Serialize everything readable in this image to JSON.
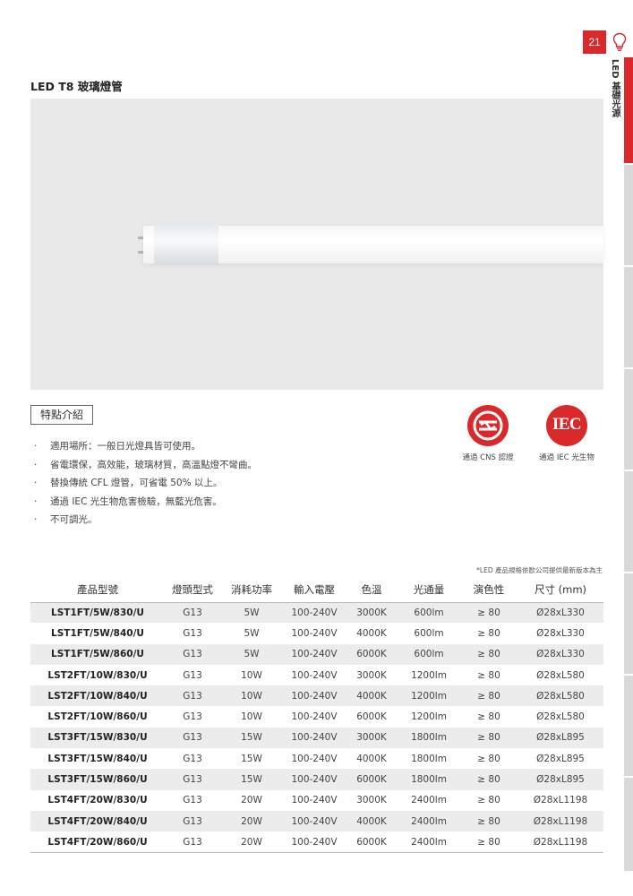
{
  "header": {
    "page_number": "21",
    "section_label": "LED 基礎光源",
    "bulb_icon": "lightbulb-icon",
    "accent_color": "#d9292a"
  },
  "title": "LED T8 玻璃燈管",
  "features": {
    "label": "特點介紹",
    "items": [
      "適用場所：一般日光燈具皆可使用。",
      "省電環保，高效能，玻璃材質，高溫點燈不彎曲。",
      "替換傳統 CFL 燈管，可省電 50% 以上。",
      "通過 IEC 光生物危害檢驗，無藍光危害。",
      "不可調光。"
    ]
  },
  "certs": {
    "cns_caption": "通過 CNS 認證",
    "iec_caption": "通過 IEC 光生物",
    "iec_text": "IEC"
  },
  "note": "*LED 產品規格依歐公司提供最新版本為主",
  "table": {
    "headers": [
      "產品型號",
      "燈頭型式",
      "消耗功率",
      "輸入電壓",
      "色溫",
      "光通量",
      "演色性",
      "尺寸 (mm)"
    ],
    "rows": [
      [
        "LST1FT/5W/830/U",
        "G13",
        "5W",
        "100-240V",
        "3000K",
        "600lm",
        "≥ 80",
        "Ø28xL330"
      ],
      [
        "LST1FT/5W/840/U",
        "G13",
        "5W",
        "100-240V",
        "4000K",
        "600lm",
        "≥ 80",
        "Ø28xL330"
      ],
      [
        "LST1FT/5W/860/U",
        "G13",
        "5W",
        "100-240V",
        "6000K",
        "600lm",
        "≥ 80",
        "Ø28xL330"
      ],
      [
        "LST2FT/10W/830/U",
        "G13",
        "10W",
        "100-240V",
        "3000K",
        "1200lm",
        "≥ 80",
        "Ø28xL580"
      ],
      [
        "LST2FT/10W/840/U",
        "G13",
        "10W",
        "100-240V",
        "4000K",
        "1200lm",
        "≥ 80",
        "Ø28xL580"
      ],
      [
        "LST2FT/10W/860/U",
        "G13",
        "10W",
        "100-240V",
        "6000K",
        "1200lm",
        "≥ 80",
        "Ø28xL580"
      ],
      [
        "LST3FT/15W/830/U",
        "G13",
        "15W",
        "100-240V",
        "3000K",
        "1800lm",
        "≥ 80",
        "Ø28xL895"
      ],
      [
        "LST3FT/15W/840/U",
        "G13",
        "15W",
        "100-240V",
        "4000K",
        "1800lm",
        "≥ 80",
        "Ø28xL895"
      ],
      [
        "LST3FT/15W/860/U",
        "G13",
        "15W",
        "100-240V",
        "6000K",
        "1800lm",
        "≥ 80",
        "Ø28xL895"
      ],
      [
        "LST4FT/20W/830/U",
        "G13",
        "20W",
        "100-240V",
        "3000K",
        "2400lm",
        "≥ 80",
        "Ø28xL1198"
      ],
      [
        "LST4FT/20W/840/U",
        "G13",
        "20W",
        "100-240V",
        "4000K",
        "2400lm",
        "≥ 80",
        "Ø28xL1198"
      ],
      [
        "LST4FT/20W/860/U",
        "G13",
        "20W",
        "100-240V",
        "6000K",
        "2400lm",
        "≥ 80",
        "Ø28xL1198"
      ]
    ]
  }
}
